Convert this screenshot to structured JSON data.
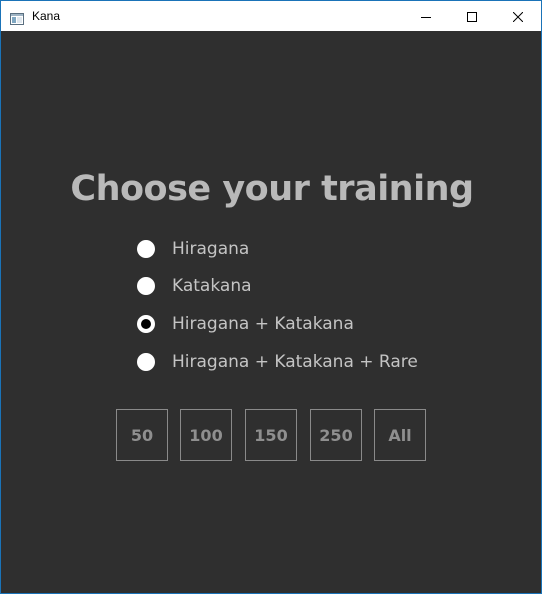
{
  "window": {
    "title": "Kana",
    "icon": "app-window-icon",
    "controls": [
      "minimize-icon",
      "maximize-icon",
      "close-icon"
    ]
  },
  "main": {
    "heading": "Choose your training",
    "options": [
      {
        "label": "Hiragana",
        "checked": false
      },
      {
        "label": "Katakana",
        "checked": false
      },
      {
        "label": "Hiragana + Katakana",
        "checked": true
      },
      {
        "label": "Hiragana + Katakana + Rare",
        "checked": false
      }
    ],
    "counts": [
      "50",
      "100",
      "150",
      "250",
      "All"
    ]
  },
  "colors": {
    "background": "#2f2f2f",
    "heading": "#b9b9b9",
    "option_text": "#c4c4c4",
    "button_text": "#8f8f8f",
    "button_border": "#8a8a8a",
    "window_border": "#1a73b8"
  }
}
